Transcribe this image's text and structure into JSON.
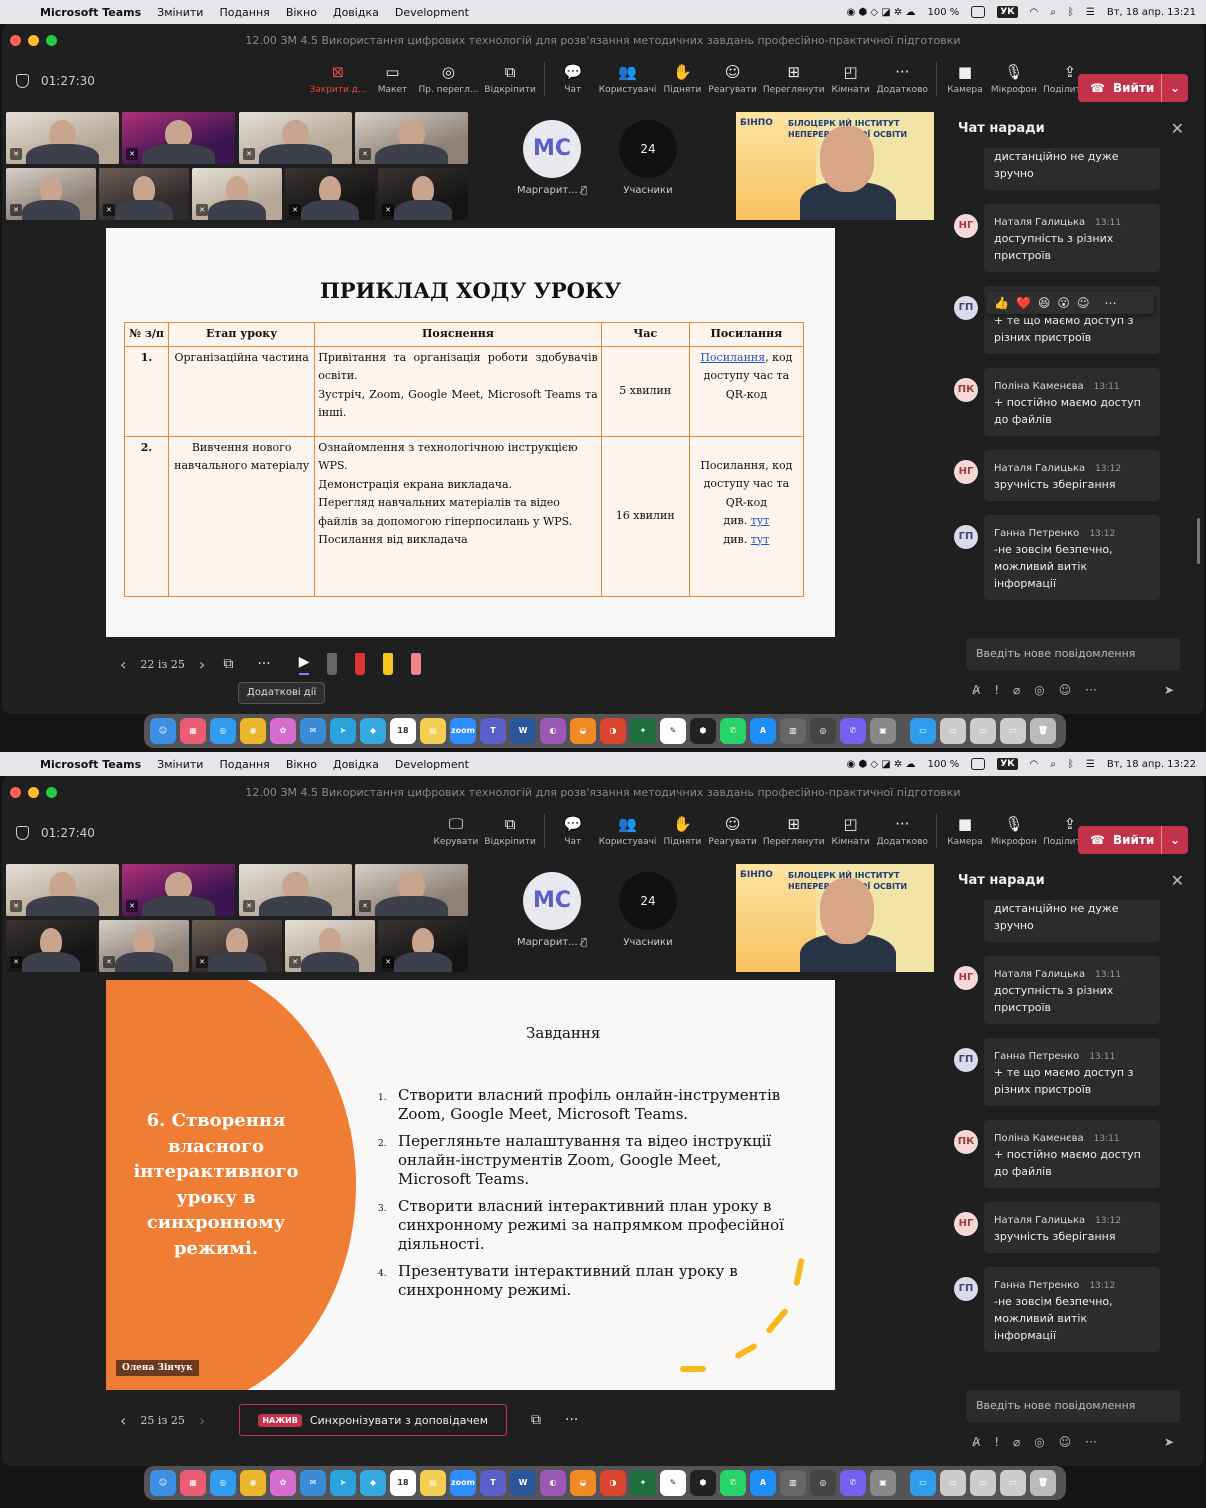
{
  "menubar": {
    "app": "Microsoft Teams",
    "items": [
      "Змінити",
      "Подання",
      "Вікно",
      "Довідка",
      "Development"
    ],
    "battery": "100 %",
    "lang": "УК",
    "datetime_1": "Вт, 18 апр.  13:21",
    "datetime_2": "Вт, 18 апр.  13:22"
  },
  "window": {
    "title": "12.00 ЗМ 4.5 Використання цифрових технологій для розв'язання методичних завдань професійно-практичної підготовки"
  },
  "toolbar": {
    "timer_1": "01:27:30",
    "timer_2": "01:27:40",
    "stop_label": "Закрити д...",
    "layout_label": "Макет",
    "preview_label": "Пр. перегл...",
    "popout_label": "Відкріпити",
    "control_label": "Керувати",
    "chat_label": "Чат",
    "users_label": "Користувачі",
    "raise_label": "Підняти",
    "react_label": "Реагувати",
    "view_label": "Переглянути",
    "rooms_label": "Кімнати",
    "more_label": "Додатково",
    "camera_label": "Камера",
    "mic_label": "Мікрофон",
    "share_label": "Поділитися",
    "leave_label": "Вийти"
  },
  "stage": {
    "avatar_initials": "МС",
    "avatar_name": "Маргарит...",
    "participants_count": "24",
    "participants_label": "Учасники",
    "speaker_banner_1": "БІНПО",
    "speaker_banner_2": "БІЛОЦЕРК    ИЙ ІНСТИТУТ НЕПЕРЕРВ    СІЙНОЇ ОСВІТИ"
  },
  "slide1": {
    "title": "ПРИКЛАД ХОДУ УРОКУ",
    "headers": [
      "№ з/п",
      "Етап уроку",
      "Пояснення",
      "Час",
      "Посилання"
    ],
    "rows": [
      {
        "n": "1.",
        "stage": "Організаційна частина",
        "desc": "Привітання та організація роботи здобувачів освіти.\nЗустріч, Zoom, Google Meet, Microsoft Teams та інші.",
        "time": "5 хвилин",
        "link": "Посилання",
        "link_rest": ", код доступу час та QR-код"
      },
      {
        "n": "2.",
        "stage": "Вивчення нового навчального матеріалу",
        "desc": "Ознайомлення з технологічною інструкцією WPS.\nДемонстрація екрана викладача.\nПерегляд навчальних матеріалів та відео файлів за допомогою гіперпосилань у WPS.\nПосилання від викладача",
        "time": "16 хвилин",
        "link_text": "Посилання, код доступу час та QR-код",
        "see1": "див. ",
        "here1": "тут",
        "see2": "див. ",
        "here2": "тут"
      }
    ],
    "page": "22 із 25",
    "tooltip": "Додаткові дії"
  },
  "slide2": {
    "left_title": "6. Створення власного інтерактивного уроку в синхронному режимі.",
    "author": "Олена Зінчук",
    "task_heading": "Завдання",
    "tasks": [
      {
        "n": "1.",
        "text": "Створити власний профіль онлайн-інструментів Zoom, Google Meet, Microsoft Teams."
      },
      {
        "n": "2.",
        "text": "Перегляньте налаштування та відео інструкції онлайн-інструментів Zoom, Google Meet, Microsoft Teams."
      },
      {
        "n": "3.",
        "text": "Створити власний інтерактивний план уроку в синхронному режимі за напрямком професійної діяльності."
      },
      {
        "n": "4.",
        "text": "Презентувати інтерактивний план уроку в синхронному режимі."
      }
    ],
    "page": "25 із 25",
    "sync_tag": "НАЖИВ",
    "sync_label": "Синхронізувати з доповідачем"
  },
  "chat": {
    "title": "Чат наради",
    "cont_text": "дистанційно не дуже зручно",
    "messages": [
      {
        "initials": "НГ",
        "name": "Наталя Галицька",
        "time": "13:11",
        "text": "доступність з різних пристроїв"
      },
      {
        "initials": "ГП",
        "name": "Ганна Петренко",
        "time": "13:11",
        "text": "+ те що маємо доступ з різних пристроїв"
      },
      {
        "initials": "ПК",
        "name": "Поліна Каменєва",
        "time": "13:11",
        "text": "+ постійно маємо доступ до файлів"
      },
      {
        "initials": "НГ",
        "name": "Наталя Галицька",
        "time": "13:12",
        "text": "зручність зберігання"
      },
      {
        "initials": "ГП",
        "name": "Ганна Петренко",
        "time": "13:12",
        "text": "-не зовсім безпечно, можливий витік інформації"
      }
    ],
    "reactions": [
      "👍",
      "❤️",
      "😆",
      "😮",
      "☺",
      "⋯"
    ],
    "composer_placeholder": "Введіть нове повідомлення"
  },
  "dock": {
    "calendar_day": "18"
  },
  "colors": {
    "accent": "#c4314b",
    "slide_orange": "#ef7d33",
    "teams_purple": "#5b5fc7"
  }
}
